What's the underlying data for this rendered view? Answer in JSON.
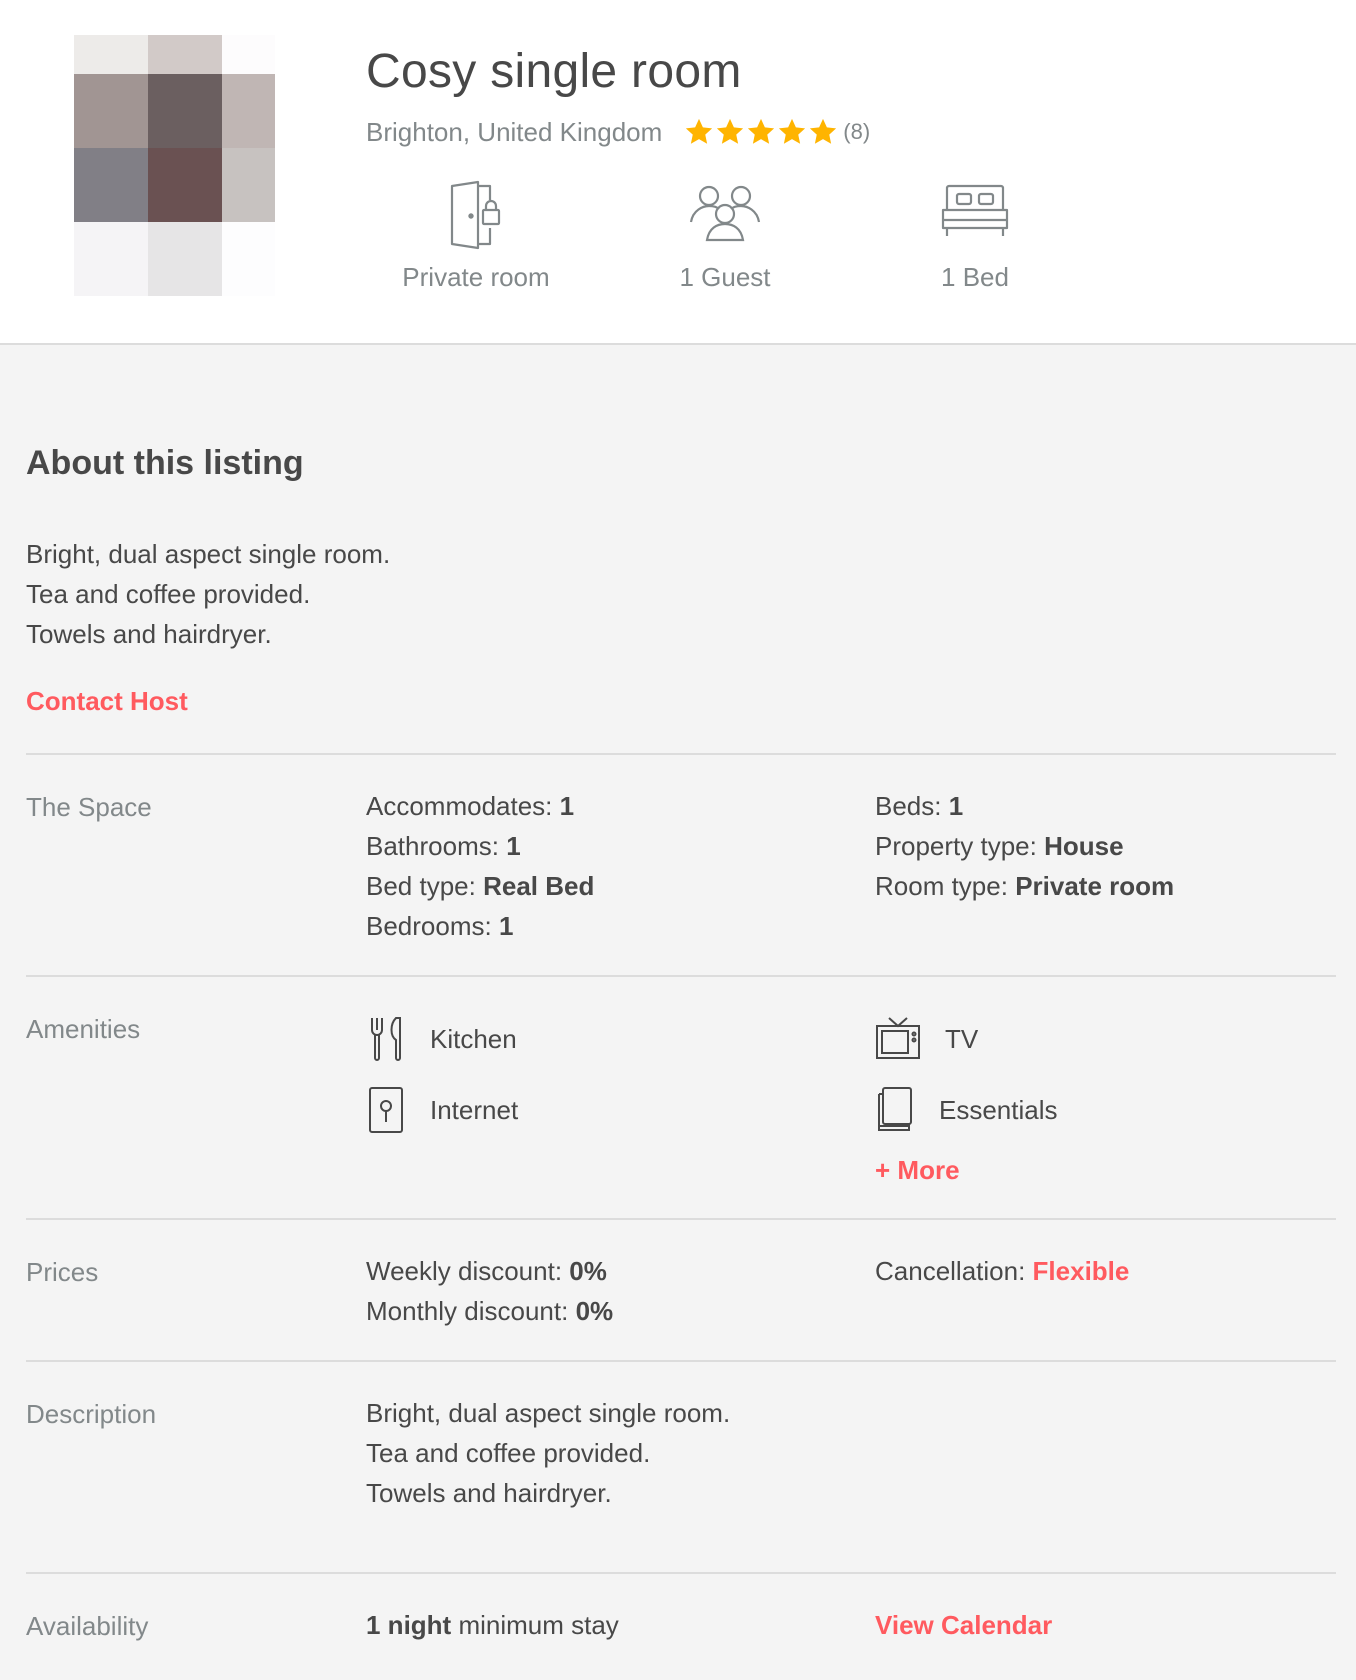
{
  "listing": {
    "title": "Cosy single room",
    "location": "Brighton, United Kingdom",
    "rating": 5,
    "review_count": "(8)",
    "colors": {
      "star": "#FFB400",
      "accent": "#FF5A5F",
      "muted": "#82888A",
      "text": "#484848"
    }
  },
  "features": [
    {
      "icon": "private-room-door-icon",
      "label": "Private room"
    },
    {
      "icon": "guests-icon",
      "label": "1 Guest"
    },
    {
      "icon": "bed-icon",
      "label": "1 Bed"
    }
  ],
  "about": {
    "title": "About this listing",
    "lines": [
      "Bright, dual aspect single room.",
      "Tea and coffee provided.",
      "Towels and hairdryer."
    ],
    "contact_label": "Contact Host"
  },
  "space": {
    "label": "The Space",
    "left": [
      {
        "key": "Accommodates:",
        "value": "1"
      },
      {
        "key": "Bathrooms:",
        "value": "1"
      },
      {
        "key": "Bed type:",
        "value": "Real Bed"
      },
      {
        "key": "Bedrooms:",
        "value": "1"
      }
    ],
    "right": [
      {
        "key": "Beds:",
        "value": "1"
      },
      {
        "key": "Property type:",
        "value": "House"
      },
      {
        "key": "Room type:",
        "value": "Private room"
      }
    ]
  },
  "amenities": {
    "label": "Amenities",
    "items": [
      {
        "icon": "kitchen-icon",
        "label": "Kitchen"
      },
      {
        "icon": "tv-icon",
        "label": "TV"
      },
      {
        "icon": "internet-icon",
        "label": "Internet"
      },
      {
        "icon": "essentials-icon",
        "label": "Essentials"
      }
    ],
    "more_label": "+ More"
  },
  "prices": {
    "label": "Prices",
    "weekly_key": "Weekly discount:",
    "weekly_value": "0%",
    "monthly_key": "Monthly discount:",
    "monthly_value": "0%",
    "cancellation_key": "Cancellation:",
    "cancellation_value": "Flexible"
  },
  "description": {
    "label": "Description",
    "lines": [
      "Bright, dual aspect single room.",
      "Tea and coffee provided.",
      "Towels and hairdryer."
    ]
  },
  "availability": {
    "label": "Availability",
    "min_stay_bold": "1 night",
    "min_stay_rest": "minimum stay",
    "calendar_label": "View Calendar"
  }
}
